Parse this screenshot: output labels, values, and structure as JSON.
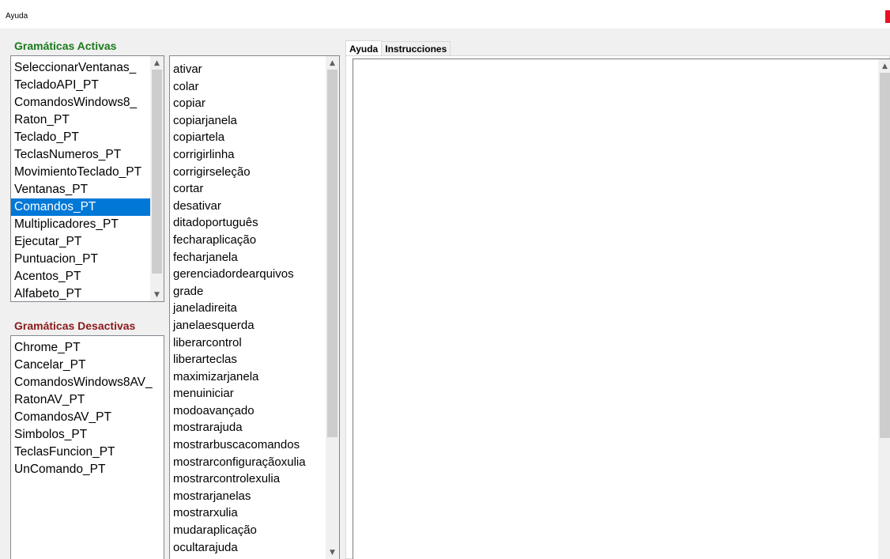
{
  "window": {
    "title": "Ayuda"
  },
  "active_grammars": {
    "label": "Gramáticas Activas",
    "items": [
      "SeleccionarVentanas_",
      "TecladoAPI_PT",
      "ComandosWindows8_",
      "Raton_PT",
      "Teclado_PT",
      "TeclasNumeros_PT",
      "MovimientoTeclado_PT",
      "Ventanas_PT",
      "Comandos_PT",
      "Multiplicadores_PT",
      "Ejecutar_PT",
      "Puntuacion_PT",
      "Acentos_PT",
      "Alfabeto_PT"
    ],
    "selected": "Comandos_PT"
  },
  "inactive_grammars": {
    "label": "Gramáticas Desactivas",
    "items": [
      "Chrome_PT",
      "Cancelar_PT",
      "ComandosWindows8AV_",
      "RatonAV_PT",
      "ComandosAV_PT",
      "Simbolos_PT",
      "TeclasFuncion_PT",
      "UnComando_PT"
    ]
  },
  "commands": {
    "items": [
      "ativar",
      "colar",
      "copiar",
      "copiarjanela",
      "copiartela",
      "corrigirlinha",
      "corrigirseleção",
      "cortar",
      "desativar",
      "ditadoportuguês",
      "fecharaplicação",
      "fecharjanela",
      "gerenciadordearquivos",
      "grade",
      "janeladireita",
      "janelaesquerda",
      "liberarcontrol",
      "liberarteclas",
      "maximizarjanela",
      "menuiniciar",
      "modoavançado",
      "mostrarajuda",
      "mostrarbuscacomandos",
      "mostrarconfiguraçãoxulia",
      "mostrarcontrolexulia",
      "mostrarjanelas",
      "mostrarxulia",
      "mudaraplicação",
      "ocultarajuda"
    ]
  },
  "tabs": [
    {
      "label": "Ayuda",
      "active": true
    },
    {
      "label": "Instrucciones",
      "active": false
    }
  ],
  "help_text": "",
  "icons": {
    "scroll_up": "chevron-up-icon",
    "scroll_down": "chevron-down-icon",
    "close": "close-icon"
  },
  "colors": {
    "active_label": "#1a7a1a",
    "inactive_label": "#8b1a1a",
    "selection": "#0078d7"
  }
}
